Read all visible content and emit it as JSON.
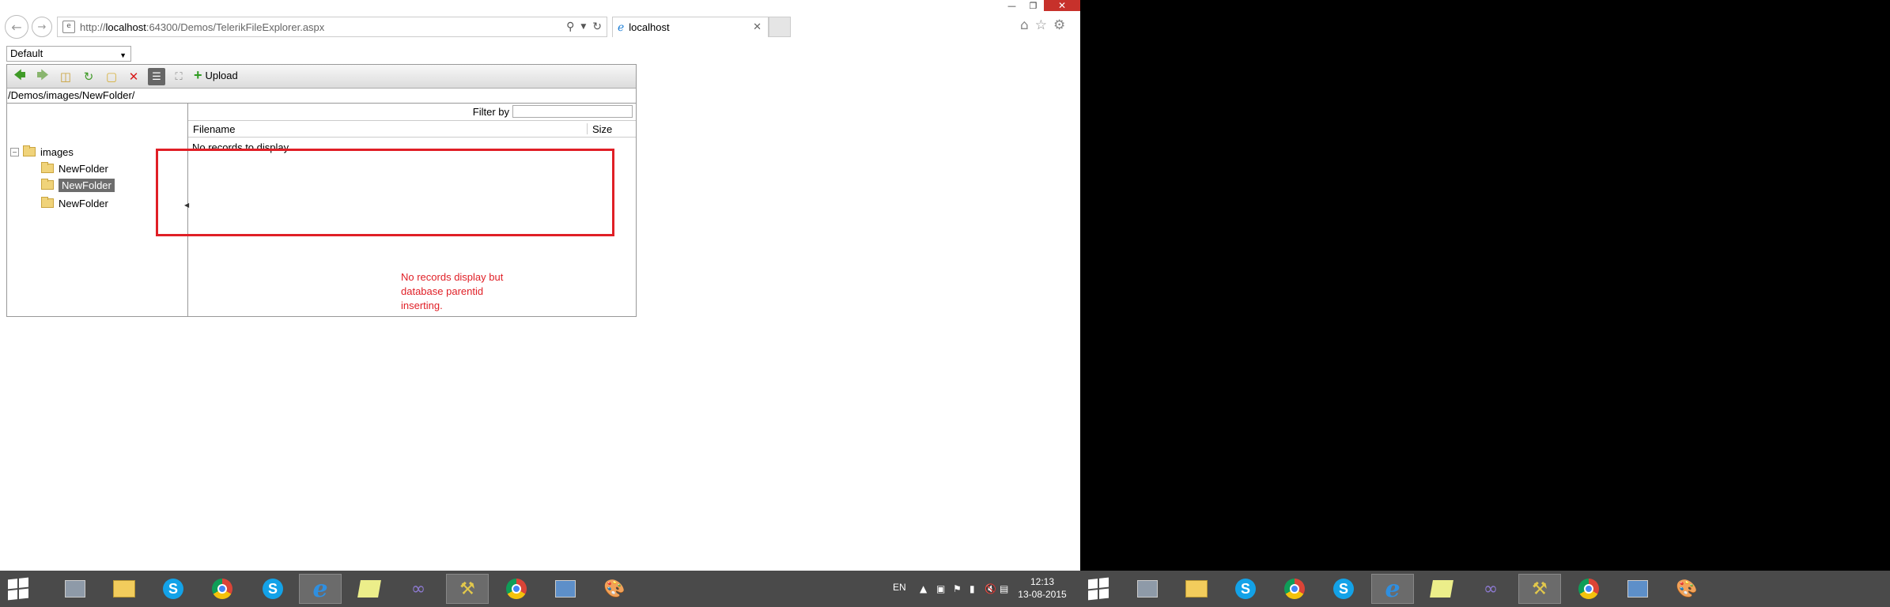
{
  "browser": {
    "url_prefix": "http://",
    "url_host": "localhost",
    "url_rest": ":64300/Demos/TelerikFileExplorer.aspx",
    "tab_title": "localhost",
    "icons": [
      "back-arrow-icon",
      "forward-arrow-icon",
      "search-icon",
      "refresh-icon",
      "home-icon",
      "star-icon",
      "gear-icon"
    ]
  },
  "page": {
    "skin_select_value": "Default",
    "toolbar": {
      "upload_label": "Upload"
    },
    "path": "/Demos/images/NewFolder/",
    "tree": {
      "root": "images",
      "children": [
        "NewFolder",
        "NewFolder",
        "NewFolder"
      ],
      "selected_index": 1
    },
    "grid": {
      "filter_label": "Filter by",
      "filter_value": "",
      "columns": [
        "Filename",
        "Size"
      ],
      "empty_message": "No records to display."
    },
    "annotation": {
      "text": "No records display but database parentid inserting.",
      "color": "#e01f26"
    }
  },
  "taskbar": {
    "language": "EN",
    "time": "12:13",
    "date": "13-08-2015"
  }
}
